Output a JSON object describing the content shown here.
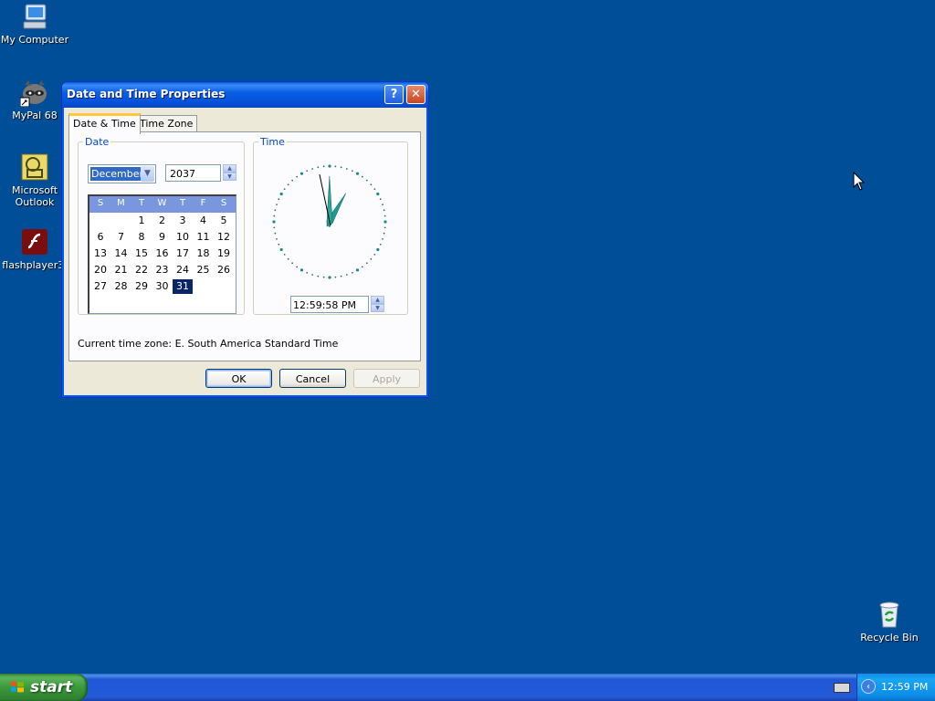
{
  "desktop": {
    "icons": [
      {
        "label": "My Computer",
        "icon": "computer-icon"
      },
      {
        "label": "MyPal 68",
        "icon": "mypal-icon"
      },
      {
        "label": "Microsoft Outlook",
        "icon": "outlook-icon"
      },
      {
        "label": "flashplayer3.",
        "icon": "flash-icon"
      },
      {
        "label": "Recycle Bin",
        "icon": "recycle-bin-icon"
      }
    ]
  },
  "window": {
    "title": "Date and Time Properties",
    "help_glyph": "?",
    "close_glyph": "✕",
    "tabs": [
      {
        "label": "Date & Time",
        "active": true
      },
      {
        "label": "Time Zone",
        "active": false
      }
    ],
    "date_group": {
      "legend": "Date",
      "month": "December",
      "year": "2037",
      "weekday_headers": [
        "S",
        "M",
        "T",
        "W",
        "T",
        "F",
        "S"
      ],
      "weeks": [
        [
          "",
          "",
          "1",
          "2",
          "3",
          "4",
          "5"
        ],
        [
          "6",
          "7",
          "8",
          "9",
          "10",
          "11",
          "12"
        ],
        [
          "13",
          "14",
          "15",
          "16",
          "17",
          "18",
          "19"
        ],
        [
          "20",
          "21",
          "22",
          "23",
          "24",
          "25",
          "26"
        ],
        [
          "27",
          "28",
          "29",
          "30",
          "31",
          "",
          ""
        ]
      ],
      "selected_day": "31"
    },
    "time_group": {
      "legend": "Time",
      "time": "12:59:58 PM",
      "clock_hours": 12,
      "clock_minutes": 59,
      "clock_seconds": 58
    },
    "timezone_line": "Current time zone:  E. South America Standard Time",
    "buttons": {
      "ok": "OK",
      "cancel": "Cancel",
      "apply": "Apply"
    }
  },
  "taskbar": {
    "start_label": "start",
    "clock": "12:59 PM"
  }
}
